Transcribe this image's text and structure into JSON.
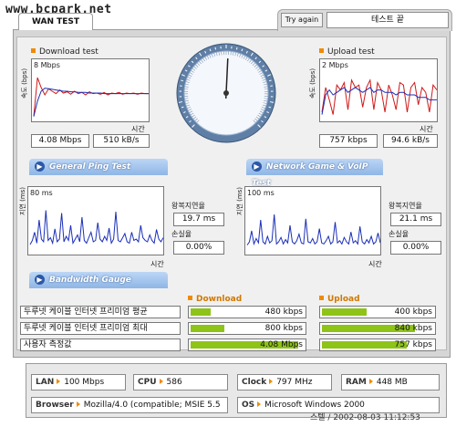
{
  "watermark": "www.bcpark.net",
  "tab": {
    "label": "WAN TEST"
  },
  "controls": {
    "try_again": "Try again",
    "status": "테스트 끝"
  },
  "download": {
    "title": "Download test",
    "ymax_label": "8 Mbps",
    "y_axis_label": "속도 (bps)",
    "x_axis_label": "시간",
    "speed": "4.08 Mbps",
    "rate": "510 kB/s"
  },
  "upload": {
    "title": "Upload test",
    "ymax_label": "2 Mbps",
    "y_axis_label": "속도 (bps)",
    "x_axis_label": "시간",
    "speed": "757 kbps",
    "rate": "94.6 kB/s"
  },
  "banners": {
    "ping": "General Ping Test",
    "game": "Network Game & VoIP Test",
    "bandwidth": "Bandwidth Gauge",
    "arrow_icon": "right-arrow-circle-icon"
  },
  "ping_general": {
    "ymax_label": "80 ms",
    "y_axis_label": "지연 (ms)",
    "x_axis_label": "시간",
    "rtt_label": "왕복지연율",
    "rtt_value": "19.7 ms",
    "loss_label": "손실율",
    "loss_value": "0.00%"
  },
  "ping_game": {
    "ymax_label": "100 ms",
    "y_axis_label": "지연 (ms)",
    "x_axis_label": "시간",
    "rtt_label": "왕복지연율",
    "rtt_value": "21.1 ms",
    "loss_label": "손실율",
    "loss_value": "0.00%"
  },
  "bandwidth": {
    "download_header": "Download",
    "upload_header": "Upload",
    "rows": [
      {
        "label": "두루넷 케이블 인터넷 프리미엄 평균",
        "download": "480 kbps",
        "download_fill": 0.18,
        "upload": "400 kbps",
        "upload_fill": 0.4
      },
      {
        "label": "두루넷 케이블 인터넷 프리미엄 최대",
        "download": "800 kbps",
        "download_fill": 0.3,
        "upload": "840 kbps",
        "upload_fill": 0.84
      },
      {
        "label": "사용자 측정값",
        "download": "4.08 Mbps",
        "download_fill": 0.95,
        "upload": "757 kbps",
        "upload_fill": 0.76
      }
    ]
  },
  "system": {
    "lan_label": "LAN",
    "lan_value": "100 Mbps",
    "cpu_label": "CPU",
    "cpu_value": "586",
    "clock_label": "Clock",
    "clock_value": "797 MHz",
    "ram_label": "RAM",
    "ram_value": "448 MB",
    "browser_label": "Browser",
    "browser_value": "Mozilla/4.0 (compatible; MSIE 5.5",
    "os_label": "OS",
    "os_value": "Microsoft Windows 2000"
  },
  "footer": "스텔 / 2002-08-03 11:12:53",
  "colors": {
    "accent_orange": "#f08a00",
    "bar_green": "#8ec318",
    "line_blue": "#1a2fb8",
    "line_red": "#d01818",
    "banner_blue": "#9bbde9"
  },
  "chart_data": [
    {
      "type": "line",
      "title": "Download test",
      "ylabel": "속도 (bps)",
      "xlabel": "시간",
      "ylim": [
        0,
        8
      ],
      "unit": "Mbps",
      "series": [
        {
          "values": [
            0.5,
            6.8,
            5.2,
            4.0,
            5.0,
            4.6,
            4.2,
            4.8,
            4.3,
            4.5,
            4.1,
            4.6,
            4.2,
            4.4,
            4.0,
            4.5,
            4.2,
            4.3,
            4.1,
            4.4,
            4.0,
            4.3,
            4.2,
            4.4,
            4.1,
            4.3,
            4.2,
            4.3,
            4.1,
            4.3,
            4.2,
            4.2
          ]
        },
        {
          "values": [
            0.5,
            3.0,
            4.6,
            5.1,
            5.0,
            4.9,
            4.8,
            4.7,
            4.6,
            4.6,
            4.5,
            4.5,
            4.4,
            4.4,
            4.4,
            4.3,
            4.3,
            4.3,
            4.3,
            4.2,
            4.2,
            4.2,
            4.2,
            4.2,
            4.2,
            4.2,
            4.2,
            4.2,
            4.2,
            4.2,
            4.2,
            4.2
          ]
        }
      ]
    },
    {
      "type": "line",
      "title": "Upload test",
      "ylabel": "속도 (bps)",
      "xlabel": "시간",
      "ylim": [
        0,
        2
      ],
      "unit": "Mbps",
      "series": [
        {
          "values": [
            0.3,
            1.3,
            0.8,
            0.2,
            1.4,
            1.2,
            1.5,
            0.4,
            1.6,
            1.3,
            1.4,
            0.5,
            1.3,
            1.6,
            0.4,
            1.5,
            1.2,
            0.3,
            1.4,
            1.0,
            0.4,
            1.5,
            1.4,
            0.3,
            1.3,
            1.5,
            0.6,
            1.3,
            1.1,
            0.3,
            1.4,
            1.2
          ]
        },
        {
          "values": [
            0.2,
            1.0,
            1.2,
            1.0,
            1.1,
            1.2,
            1.3,
            1.1,
            1.2,
            1.3,
            1.2,
            1.1,
            1.2,
            1.3,
            1.1,
            1.2,
            1.2,
            1.1,
            1.1,
            1.1,
            1.0,
            1.1,
            1.1,
            1.0,
            1.0,
            1.0,
            0.9,
            0.9,
            0.9,
            0.8,
            0.8,
            0.8
          ]
        }
      ]
    },
    {
      "type": "line",
      "title": "General Ping Test",
      "ylabel": "지연 (ms)",
      "xlabel": "시간",
      "ylim": [
        0,
        80
      ],
      "unit": "ms",
      "series": [
        {
          "values": [
            12,
            18,
            30,
            14,
            48,
            20,
            16,
            62,
            18,
            22,
            14,
            35,
            16,
            20,
            58,
            16,
            24,
            18,
            40,
            14,
            20,
            26,
            16,
            52,
            18,
            14,
            22,
            30,
            16,
            18,
            44,
            20,
            16,
            24,
            18,
            36,
            14,
            20,
            60,
            18,
            16,
            22,
            28,
            16,
            14,
            30,
            18,
            20,
            16,
            40,
            22,
            18,
            16,
            26,
            18,
            14,
            34,
            20,
            16,
            22
          ]
        }
      ]
    },
    {
      "type": "line",
      "title": "Network Game & VoIP Test",
      "ylabel": "지연 (ms)",
      "xlabel": "시간",
      "ylim": [
        0,
        100
      ],
      "unit": "ms",
      "series": [
        {
          "values": [
            14,
            20,
            40,
            16,
            26,
            18,
            60,
            20,
            16,
            30,
            18,
            22,
            70,
            16,
            20,
            28,
            16,
            24,
            18,
            50,
            20,
            16,
            22,
            34,
            18,
            16,
            62,
            20,
            18,
            26,
            16,
            20,
            44,
            18,
            16,
            22,
            30,
            16,
            20,
            56,
            18,
            22,
            16,
            28,
            20,
            16,
            38,
            18,
            22,
            16,
            48,
            20,
            16,
            24,
            18,
            30,
            16,
            20,
            36,
            18
          ]
        }
      ]
    }
  ]
}
